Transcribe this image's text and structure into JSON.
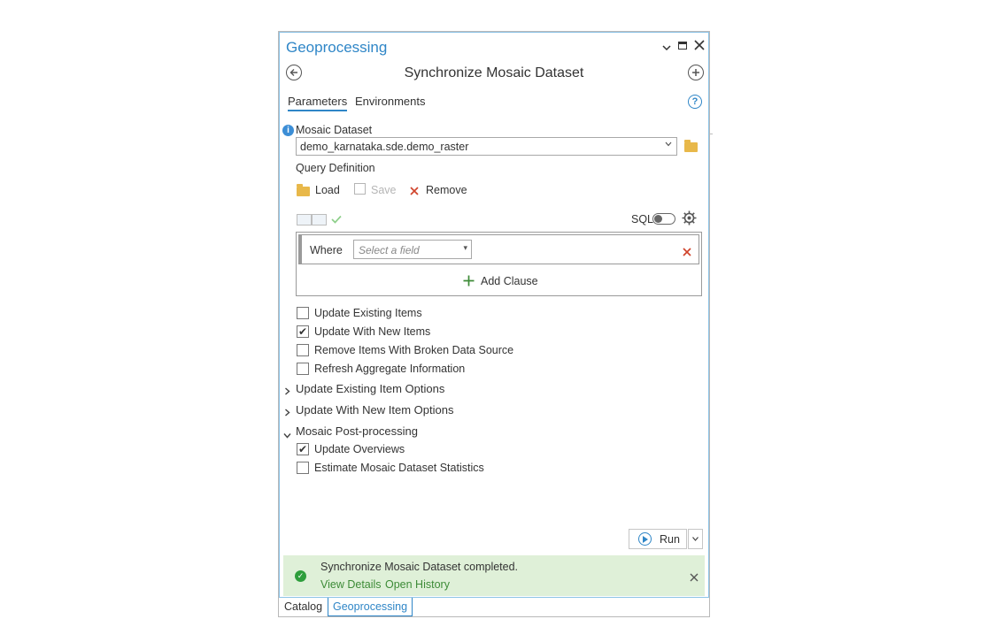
{
  "pane": {
    "title": "Geoprocessing",
    "tool_title": "Synchronize Mosaic Dataset",
    "tabs": [
      {
        "label": "Parameters"
      },
      {
        "label": "Environments"
      }
    ],
    "help_glyph": "?"
  },
  "mosaic_dataset": {
    "label": "Mosaic Dataset",
    "value": "demo_karnataka.sde.demo_raster"
  },
  "query": {
    "label": "Query Definition",
    "load": "Load",
    "save": "Save",
    "remove": "Remove",
    "sql_label": "SQL",
    "where_label": "Where",
    "field_placeholder": "Select a field",
    "add_clause": "Add Clause"
  },
  "options": [
    {
      "label": "Update Existing Items",
      "checked": false
    },
    {
      "label": "Update With New Items",
      "checked": true
    },
    {
      "label": "Remove Items With Broken Data Source",
      "checked": false
    },
    {
      "label": "Refresh Aggregate Information",
      "checked": false
    }
  ],
  "sections": [
    {
      "label": "Update Existing Item Options",
      "expanded": false
    },
    {
      "label": "Update With New Item Options",
      "expanded": false
    },
    {
      "label": "Mosaic Post-processing",
      "expanded": true
    }
  ],
  "post_processing": [
    {
      "label": "Update Overviews",
      "checked": true
    },
    {
      "label": "Estimate Mosaic Dataset Statistics",
      "checked": false
    }
  ],
  "run": {
    "label": "Run"
  },
  "message": {
    "text": "Synchronize Mosaic Dataset completed.",
    "view_details": "View Details",
    "open_history": "Open History"
  },
  "bottom_tabs": [
    {
      "label": "Catalog"
    },
    {
      "label": "Geoprocessing"
    }
  ],
  "colors": {
    "accent": "#2f86c7",
    "success_bg": "#dff0d8",
    "success": "#2e9e3c",
    "danger": "#d0442c"
  },
  "glyphs": {
    "check": "✔",
    "close": "✕",
    "chev_right": "›",
    "chev_down": "⌄"
  }
}
